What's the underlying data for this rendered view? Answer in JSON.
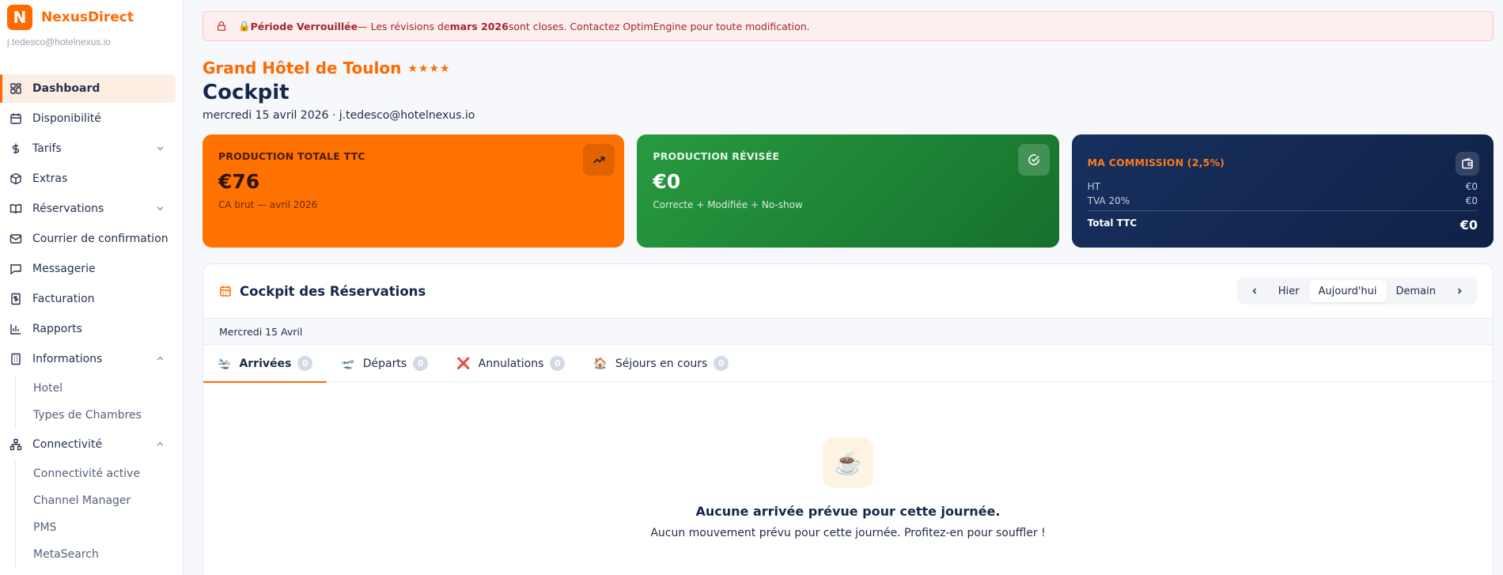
{
  "brand": {
    "logo_letter": "N",
    "name": "NexusDirect",
    "email": "j.tedesco@hotelnexus.io"
  },
  "sidebar": {
    "items": [
      {
        "label": "Dashboard",
        "icon": "dashboard-icon",
        "active": true
      },
      {
        "label": "Disponibilité",
        "icon": "calendar-icon"
      },
      {
        "label": "Tarifs",
        "icon": "dollar-icon",
        "expandable": "down"
      },
      {
        "label": "Extras",
        "icon": "box-icon"
      },
      {
        "label": "Réservations",
        "icon": "book-icon",
        "expandable": "down"
      },
      {
        "label": "Courrier de confirmation",
        "icon": "mail-icon"
      },
      {
        "label": "Messagerie",
        "icon": "chat-icon"
      },
      {
        "label": "Facturation",
        "icon": "invoice-icon"
      },
      {
        "label": "Rapports",
        "icon": "bar-chart-icon"
      },
      {
        "label": "Informations",
        "icon": "building-icon",
        "expandable": "up"
      },
      {
        "label": "Connectivité",
        "icon": "network-icon",
        "expandable": "up"
      }
    ],
    "informations_sub": [
      "Hotel",
      "Types de Chambres"
    ],
    "connectivite_sub": [
      "Connectivité active",
      "Channel Manager",
      "PMS",
      "MetaSearch"
    ]
  },
  "alert": {
    "prefix": "🔒 ",
    "title": "Période Verrouillée",
    "text_before": " — Les révisions de ",
    "month": "mars 2026",
    "text_after": " sont closes. Contactez OptimEngine pour toute modification."
  },
  "header": {
    "hotel": "Grand Hôtel de Toulon",
    "stars": "★★★★",
    "title": "Cockpit",
    "subtitle": "mercredi 15 avril 2026 · j.tedesco@hotelnexus.io"
  },
  "cards": {
    "production": {
      "label": "PRODUCTION TOTALE TTC",
      "value": "€76",
      "note": "CA brut — avril 2026"
    },
    "revised": {
      "label": "PRODUCTION RÉVISÉE",
      "value": "€0",
      "note": "Correcte + Modifiée + No-show"
    },
    "commission": {
      "label": "MA COMMISSION (2,5%)",
      "ht_label": "HT",
      "ht_value": "€0",
      "tva_label": "TVA 20%",
      "tva_value": "€0",
      "total_label": "Total TTC",
      "total_value": "€0"
    }
  },
  "reservations": {
    "title": "Cockpit des Réservations",
    "nav": {
      "prev": "Hier",
      "current": "Aujourd'hui",
      "next": "Demain"
    },
    "date": "Mercredi 15 Avril",
    "tabs": [
      {
        "emoji": "🛬",
        "label": "Arrivées",
        "count": "0",
        "active": true
      },
      {
        "emoji": "🛫",
        "label": "Départs",
        "count": "0"
      },
      {
        "emoji": "❌",
        "label": "Annulations",
        "count": "0"
      },
      {
        "emoji": "🏠",
        "label": "Séjours en cours",
        "count": "0"
      }
    ],
    "empty": {
      "emoji": "☕",
      "title": "Aucune arrivée prévue pour cette journée.",
      "text": "Aucun mouvement prévu pour cette journée. Profitez-en pour souffler !"
    }
  },
  "colors": {
    "accent": "#ff6a00",
    "success": "#1f8a38",
    "navy": "#14295a",
    "alert": "#a2262d"
  }
}
